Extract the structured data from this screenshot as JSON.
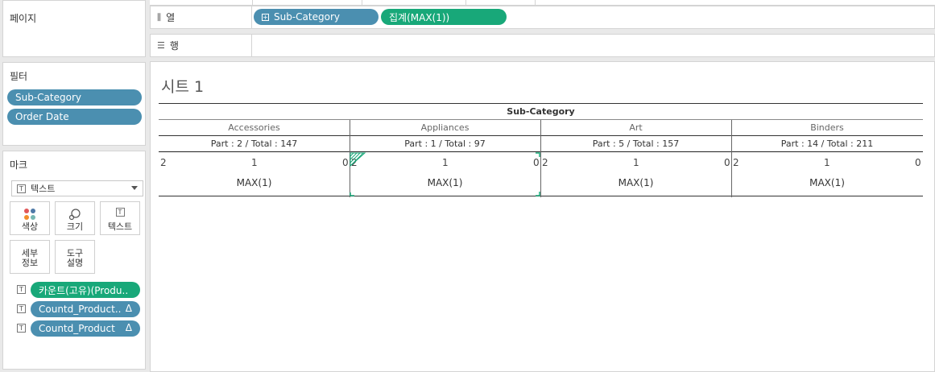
{
  "left": {
    "pages_title": "페이지",
    "filters_title": "필터",
    "filters": [
      "Sub-Category",
      "Order Date"
    ],
    "marks_title": "마크",
    "mark_type": "텍스트",
    "mark_buttons": [
      {
        "icon": "color-icon",
        "label": "색상"
      },
      {
        "icon": "size-icon",
        "label": "크기"
      },
      {
        "icon": "text-icon",
        "label": "텍스트"
      },
      {
        "icon": "detail-icon",
        "label": "세부\n정보"
      },
      {
        "icon": "tooltip-icon",
        "label": "도구\n설명"
      }
    ],
    "mark_fields": [
      {
        "label": "카운트(고유)(Produ..",
        "color": "#18a879",
        "delta": ""
      },
      {
        "label": "Countd_Product..",
        "color": "#4b8fb0",
        "delta": "Δ"
      },
      {
        "label": "Countd_Product",
        "color": "#4b8fb0",
        "delta": "Δ"
      }
    ]
  },
  "shelves": {
    "columns_label": "열",
    "columns_pills": [
      "Sub-Category",
      "집계(MAX(1))"
    ],
    "rows_label": "행"
  },
  "sheet": {
    "title": "시트 1",
    "header_title": "Sub-Category",
    "columns": [
      {
        "name": "Accessories",
        "part": "Part : 2 / Total : 147"
      },
      {
        "name": "Appliances",
        "part": "Part : 1 / Total : 97"
      },
      {
        "name": "Art",
        "part": "Part : 5 / Total : 157"
      },
      {
        "name": "Binders",
        "part": "Part : 14 / Total : 211"
      }
    ],
    "axis_ticks": [
      "2",
      "1",
      "0"
    ],
    "measure_label": "MAX(1)"
  },
  "colors": {
    "blue_pill": "#4b8fb0",
    "green_pill": "#18a879"
  }
}
